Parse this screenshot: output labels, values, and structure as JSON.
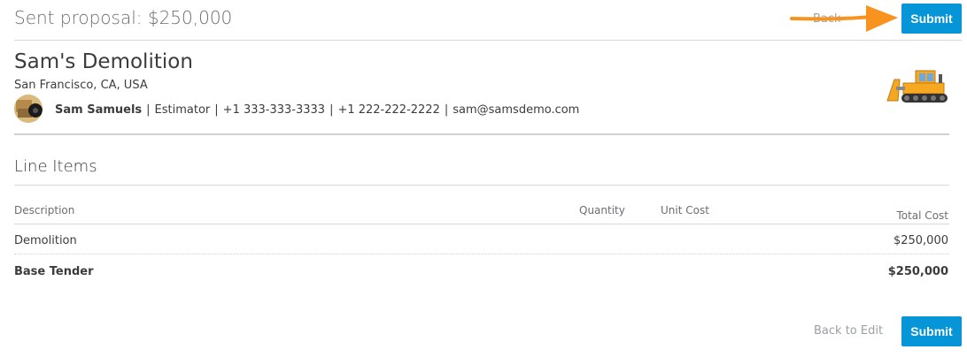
{
  "header": {
    "title": "Sent proposal: $250,000",
    "back_label": "Back",
    "submit_label": "Submit"
  },
  "company": {
    "name": "Sam's Demolition",
    "address": "San Francisco, CA, USA",
    "contact": {
      "name": "Sam Samuels",
      "role": "Estimator",
      "phone1": "+1 333-333-3333",
      "phone2": "+1 222-222-2222",
      "email": "sam@samsdemo.com"
    },
    "logo_icon": "bulldozer-icon"
  },
  "line_items": {
    "title": "Line Items",
    "columns": [
      "Description",
      "Quantity",
      "Unit Cost",
      "Total Cost"
    ],
    "rows": [
      {
        "description": "Demolition",
        "quantity": "",
        "unit_cost": "",
        "total": "$250,000"
      }
    ],
    "base": {
      "label": "Base Tender",
      "total": "$250,000"
    }
  },
  "footer": {
    "back_label": "Back to Edit",
    "submit_label": "Submit"
  },
  "colors": {
    "accent": "#0696d7",
    "arrow": "#f7931e"
  }
}
